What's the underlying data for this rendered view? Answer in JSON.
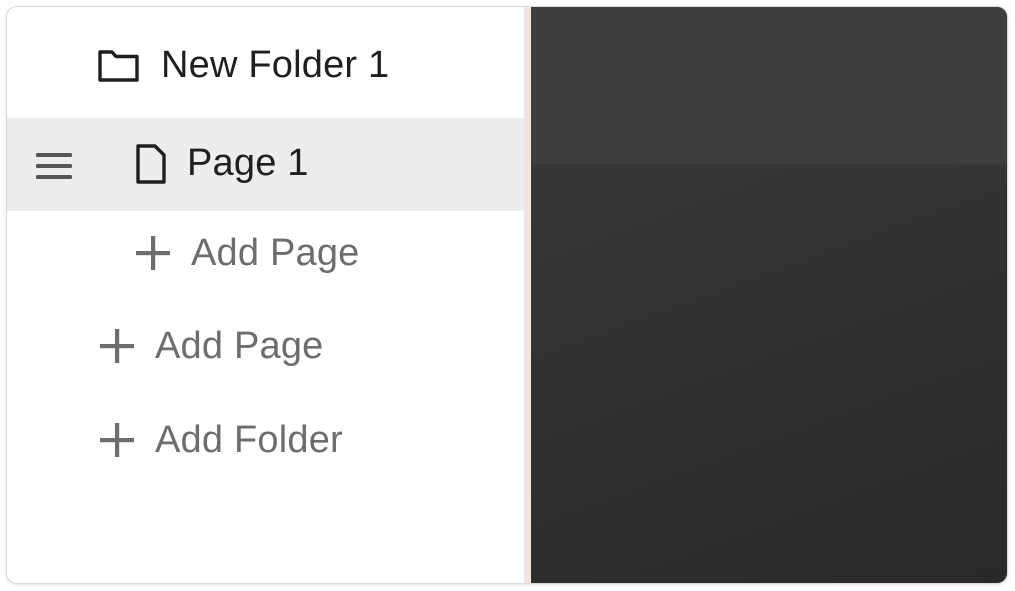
{
  "sidebar": {
    "folder": {
      "label": "New Folder 1",
      "icon": "folder-icon"
    },
    "selected_page": {
      "label": "Page 1",
      "icon": "page-icon",
      "handle_icon": "drag-handle-icon",
      "highlight_color": "#ededed"
    },
    "folder_add_page": {
      "label": "Add Page",
      "icon": "plus-icon"
    },
    "add_page": {
      "label": "Add Page",
      "icon": "plus-icon"
    },
    "add_folder": {
      "label": "Add Folder",
      "icon": "plus-icon"
    }
  },
  "colors": {
    "text_primary": "#1f1f1f",
    "text_secondary": "#6d6d6d",
    "preview_background": "#333331",
    "divider": "#efe6e1"
  }
}
